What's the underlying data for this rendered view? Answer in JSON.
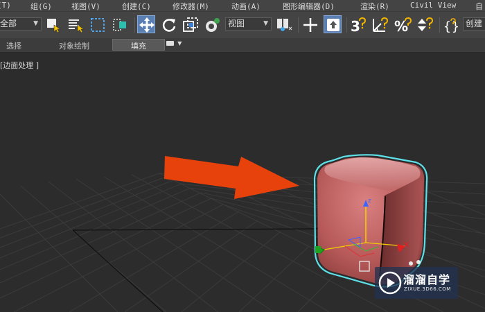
{
  "menu": [
    {
      "id": "tools",
      "label": "(T)"
    },
    {
      "id": "group",
      "label": "组(G)"
    },
    {
      "id": "views",
      "label": "视图(V)"
    },
    {
      "id": "create",
      "label": "创建(C)"
    },
    {
      "id": "modifiers",
      "label": "修改器(M)"
    },
    {
      "id": "animation",
      "label": "动画(A)"
    },
    {
      "id": "graph_editors",
      "label": "图形编辑器(D)"
    },
    {
      "id": "rendering",
      "label": "渲染(R)"
    },
    {
      "id": "civil_view",
      "label": "Civil View"
    },
    {
      "id": "customize",
      "label": "自"
    }
  ],
  "toolbar": {
    "selection_filter": "全部",
    "ref_coord_system": "视图",
    "create_selection_set": "创建选"
  },
  "ribbon": {
    "tabs": [
      {
        "id": "selection",
        "label": "选择"
      },
      {
        "id": "object_paint",
        "label": "对象绘制"
      },
      {
        "id": "populate",
        "label": "填充"
      }
    ],
    "active": "populate"
  },
  "viewport": {
    "label": "[边面处理 ]",
    "gizmo_axis": "z"
  },
  "watermark": {
    "title": "溜溜自学",
    "url": "ZIXUE.3D66.COM"
  },
  "colors": {
    "menubar_bg": "#444444",
    "viewport_bg": "#2c2c2c",
    "selection_outline": "#5fe0e8",
    "box_color": "#b85a5a",
    "arrow_color": "#e8420c",
    "active_tool": "#5a7fb3"
  }
}
